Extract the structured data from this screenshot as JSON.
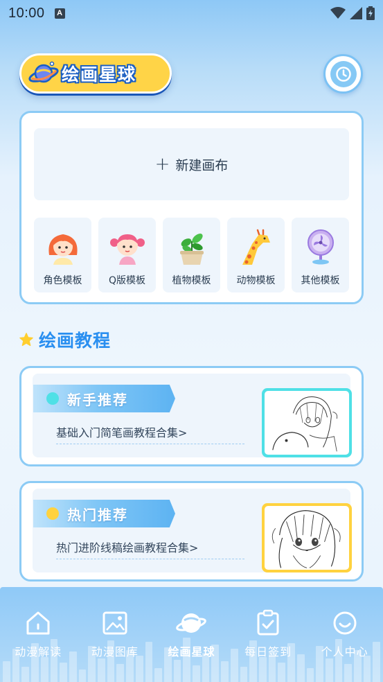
{
  "status_bar": {
    "time": "10:00",
    "notification_glyph": "A",
    "icons": [
      "wifi-icon",
      "signal-icon",
      "battery-charging-icon"
    ]
  },
  "header": {
    "app_title": "绘画星球",
    "logo_icon": "planet-icon",
    "history_icon": "clock-icon"
  },
  "create_panel": {
    "new_canvas_plus": "+",
    "new_canvas_label": "新建画布",
    "templates": [
      {
        "label": "角色模板",
        "icon": "character-girl-icon"
      },
      {
        "label": "Q版模板",
        "icon": "chibi-girl-icon"
      },
      {
        "label": "植物模板",
        "icon": "potted-plant-icon"
      },
      {
        "label": "动物模板",
        "icon": "giraffe-icon"
      },
      {
        "label": "其他模板",
        "icon": "fan-icon"
      }
    ]
  },
  "tutorial_section": {
    "title": "绘画教程",
    "icon": "star-icon"
  },
  "tutorials": [
    {
      "title": "新手推荐",
      "desc": "基础入门简笔画教程合集>",
      "dot_color": "#4fe0e6",
      "frame_color": "#4fe0e6",
      "thumb": "anime-sketch-thumbnail"
    },
    {
      "title": "热门推荐",
      "desc": "热门进阶线稿绘画教程合集>",
      "dot_color": "#ffd23f",
      "frame_color": "#ffd23f",
      "thumb": "anime-lineart-thumbnail"
    }
  ],
  "bottom_nav": {
    "active_index": 2,
    "items": [
      {
        "label": "动漫解读",
        "icon": "home-icon"
      },
      {
        "label": "动漫图库",
        "icon": "gallery-icon"
      },
      {
        "label": "绘画星球",
        "icon": "planet-icon"
      },
      {
        "label": "每日签到",
        "icon": "clipboard-check-icon"
      },
      {
        "label": "个人中心",
        "icon": "smile-icon"
      }
    ]
  },
  "colors": {
    "accent_blue": "#2a8ff0",
    "panel_border": "#8ccbf5",
    "logo_yellow": "#ffd447"
  }
}
